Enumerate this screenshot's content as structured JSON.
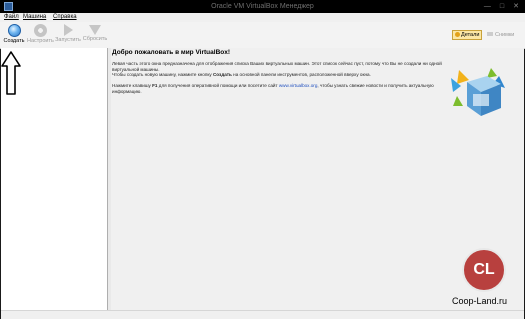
{
  "window": {
    "title": "Oracle VM VirtualBox Менеджер"
  },
  "menu": {
    "items": [
      "Файл",
      "Машина",
      "Справка"
    ]
  },
  "toolbar": {
    "buttons": [
      {
        "label": "Создать",
        "icon": "new-vm-icon",
        "enabled": true
      },
      {
        "label": "Настроить",
        "icon": "settings-gear-icon",
        "enabled": false
      },
      {
        "label": "Запустить",
        "icon": "start-arrow-icon",
        "enabled": false
      },
      {
        "label": "Сбросить",
        "icon": "discard-arrow-icon",
        "enabled": false
      }
    ],
    "details_label": "Детали",
    "snapshots_label": "Снимки"
  },
  "welcome": {
    "title": "Добро пожаловать в мир VirtualBox!",
    "p1": "Левая часть этого окна предназначена для отображения списка Ваших виртуальных машин. Этот список сейчас пуст, потому что Вы не создали ни одной виртуальной машины.",
    "p2_before": "Чтобы создать новую машину, нажмите кнопку ",
    "p2_bold": "Создать",
    "p2_after": " на основной панели инструментов, расположенной вверху окна.",
    "p3_before": "Нажмите клавишу ",
    "p3_bold": "F1",
    "p3_mid": " для получения оперативной помощи или посетите сайт ",
    "p3_link": "www.virtualbox.org",
    "p3_after": ", чтобы узнать свежие новости и получить актуальную информацию."
  },
  "watermark": {
    "logo_text": "CL",
    "site": "Coop-Land.ru"
  },
  "colors": {
    "accent": "#2a74c4",
    "details_bg": "#fbe7a5",
    "watermark_red": "#b8403e"
  }
}
